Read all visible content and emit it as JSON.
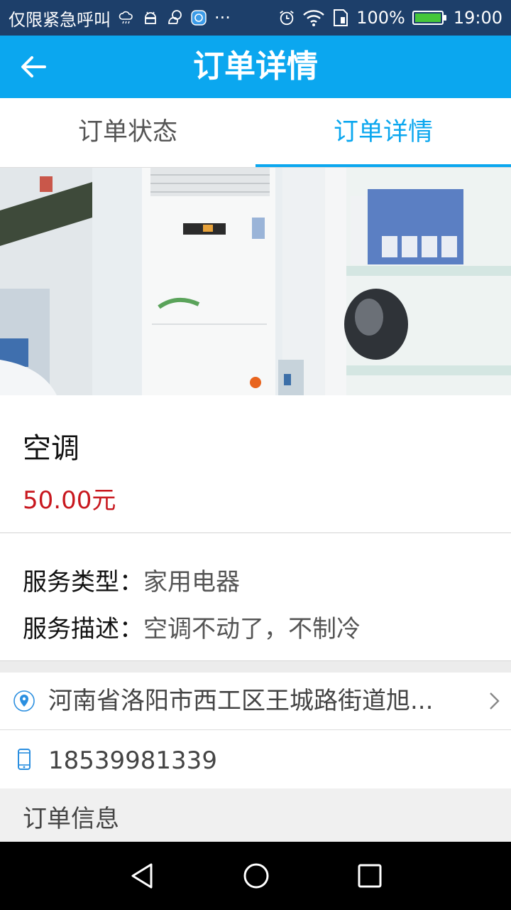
{
  "status_bar": {
    "carrier_text": "仅限紧急呼叫",
    "more_text": "···",
    "battery_text": "100%",
    "time": "19:00"
  },
  "app_bar": {
    "title": "订单详情"
  },
  "tabs": [
    {
      "label": "订单状态",
      "active": false
    },
    {
      "label": "订单详情",
      "active": true
    }
  ],
  "carousel": {
    "page_count": 1,
    "current_page": 1
  },
  "product": {
    "name": "空调",
    "price": "50.00元"
  },
  "service": {
    "type_label": "服务类型：",
    "type_value": "家用电器",
    "desc_label": "服务描述：",
    "desc_value": "空调不动了，不制冷"
  },
  "address": {
    "text": "河南省洛阳市西工区王城路街道旭..."
  },
  "phone": {
    "number": "18539981339"
  },
  "order_info": {
    "title": "订单信息"
  },
  "colors": {
    "status_bar": "#1d3f6a",
    "app_bar": "#0ba7ef",
    "tab_active": "#0ba7ef",
    "price": "#c8171e",
    "indicator_dot": "#e8641e"
  }
}
